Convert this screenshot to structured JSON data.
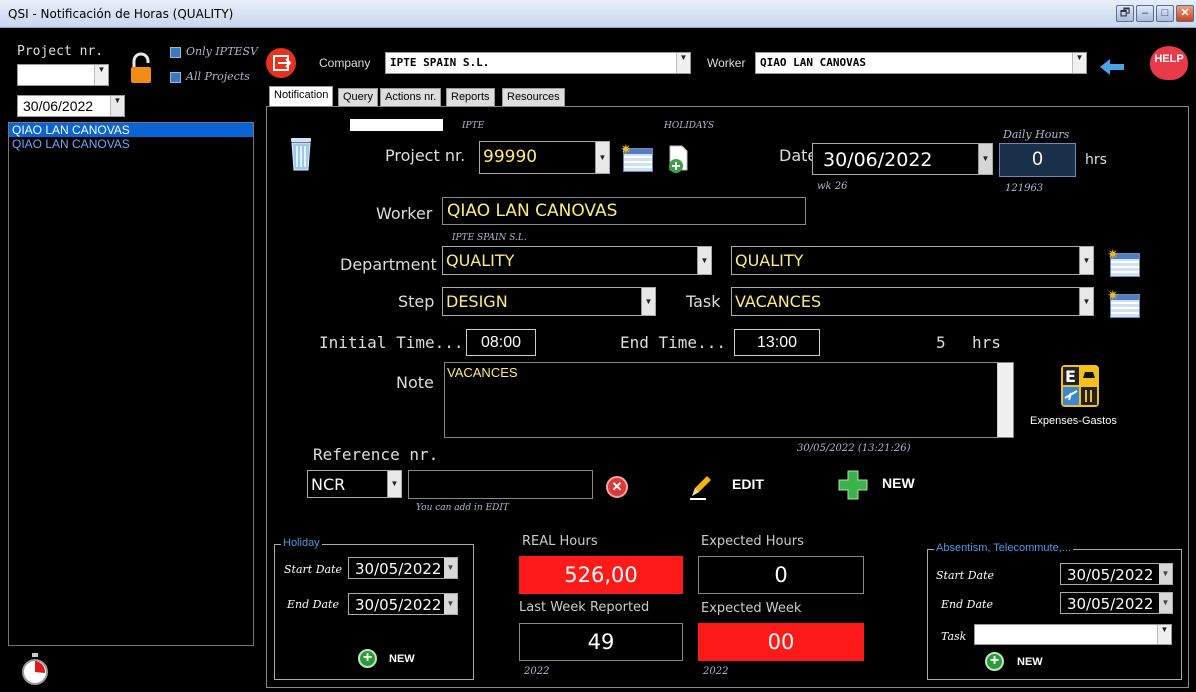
{
  "window": {
    "title": "QSI - Notificación de Horas (QUALITY)",
    "restore_glyph": "🗗",
    "min_glyph": "–",
    "max_glyph": "□",
    "close_glyph": "✕"
  },
  "sidebar": {
    "project_label": "Project nr.",
    "project_value": "",
    "only_iptesv": "Only IPTESV",
    "all_projects": "All Projects",
    "date": "30/06/2022",
    "workers": [
      "QIAO LAN CANOVAS",
      "QIAO LAN CANOVAS"
    ]
  },
  "header": {
    "company_label": "Company",
    "company_value": "IPTE SPAIN S.L.",
    "worker_label": "Worker",
    "worker_value": "QIAO LAN CANOVAS",
    "help": "HELP"
  },
  "tabs": [
    "Notification",
    "Query",
    "Actions nr.",
    "Reports",
    "Resources"
  ],
  "form": {
    "ipte": "IPTE",
    "holidays": "HOLIDAYS",
    "daily_hours_label": "Daily Hours",
    "project_label": "Project nr.",
    "project_value": "99990",
    "date_label": "Date",
    "date_value": "30/06/2022",
    "week": "wk 26",
    "daily_hours_value": "0",
    "hrs": "hrs",
    "id": "121963",
    "worker_label": "Worker",
    "worker_value": "QIAO LAN CANOVAS",
    "worker_company": "IPTE SPAIN S.L.",
    "department_label": "Department",
    "department_value": "QUALITY",
    "department_value2": "QUALITY",
    "step_label": "Step",
    "step_value": "DESIGN",
    "task_label": "Task",
    "task_value": "VACANCES",
    "initial_label": "Initial Time...",
    "initial_value": "08:00",
    "end_label": "End Time...",
    "end_value": "13:00",
    "total_hours": "5",
    "total_hrs": "hrs",
    "note_label": "Note",
    "note_value": "VACANCES",
    "expenses": "Expenses-Gastos",
    "timestamp": "30/05/2022 (13:21:26)",
    "reference_label": "Reference nr.",
    "reference_type": "NCR",
    "reference_value": "",
    "reference_hint": "You can add in EDIT",
    "edit": "EDIT",
    "new": "NEW"
  },
  "holiday": {
    "title": "Holiday",
    "start_label": "Start Date",
    "start_value": "30/05/2022",
    "end_label": "End Date",
    "end_value": "30/05/2022",
    "new": "NEW"
  },
  "stats": {
    "real_label": "REAL Hours",
    "real_value": "526,00",
    "expected_label": "Expected Hours",
    "expected_value": "0",
    "lastweek_label": "Last Week Reported",
    "lastweek_value": "49",
    "expweek_label": "Expected Week",
    "expweek_value": "00",
    "year1": "2022",
    "year2": "2022",
    "alert_color": "#ff1a1a"
  },
  "absentism": {
    "title": "Absentism, Telecommute,...",
    "start_label": "Start Date",
    "start_value": "30/05/2022",
    "end_label": "End Date",
    "end_value": "30/05/2022",
    "task_label": "Task",
    "task_value": "",
    "new": "NEW"
  }
}
